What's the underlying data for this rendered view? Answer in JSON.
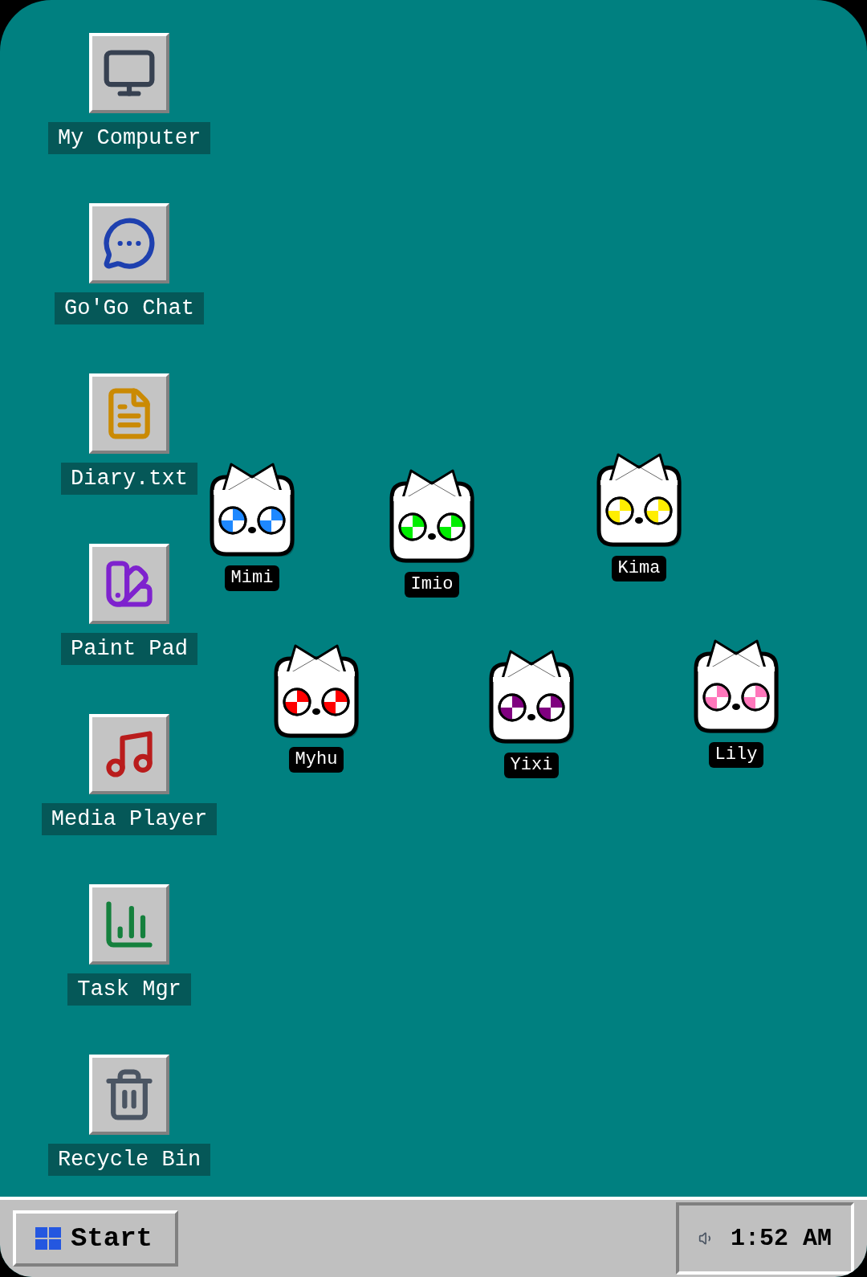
{
  "desktop_icons": [
    {
      "kind": "computer",
      "label": "My Computer"
    },
    {
      "kind": "chat",
      "label": "Go'Go Chat"
    },
    {
      "kind": "document",
      "label": "Diary.txt"
    },
    {
      "kind": "paint",
      "label": "Paint Pad"
    },
    {
      "kind": "music",
      "label": "Media Player"
    },
    {
      "kind": "chart",
      "label": "Task Mgr"
    },
    {
      "kind": "trash",
      "label": "Recycle Bin"
    }
  ],
  "cats": [
    {
      "name": "Mimi",
      "color": "#1e88ff"
    },
    {
      "name": "Imio",
      "color": "#00ee00"
    },
    {
      "name": "Kima",
      "color": "#ffee00"
    },
    {
      "name": "Myhu",
      "color": "#ff0000"
    },
    {
      "name": "Yixi",
      "color": "#800080"
    },
    {
      "name": "Lily",
      "color": "#ff77bb"
    }
  ],
  "taskbar": {
    "start": "Start",
    "clock": "1:52 AM"
  }
}
